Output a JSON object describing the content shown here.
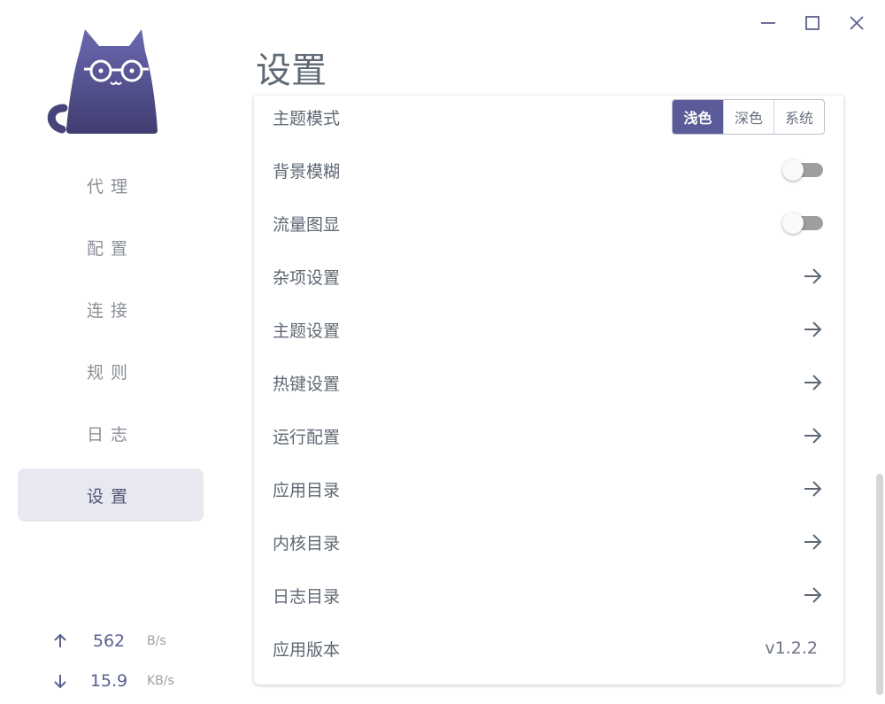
{
  "window": {
    "controls": [
      "minimize-icon",
      "maximize-icon",
      "close-icon"
    ],
    "icon_color": "#5b5f8f"
  },
  "sidebar": {
    "nav": [
      {
        "label": "代理",
        "active": false
      },
      {
        "label": "配置",
        "active": false
      },
      {
        "label": "连接",
        "active": false
      },
      {
        "label": "规则",
        "active": false
      },
      {
        "label": "日志",
        "active": false
      },
      {
        "label": "设置",
        "active": true
      }
    ],
    "traffic": {
      "upload": {
        "value": "562",
        "unit": "B/s"
      },
      "download": {
        "value": "15.9",
        "unit": "KB/s"
      }
    }
  },
  "page": {
    "title": "设置"
  },
  "settings": {
    "theme_mode": {
      "label": "主题模式",
      "options": [
        "浅色",
        "深色",
        "系统"
      ],
      "selected": "浅色"
    },
    "background_blur": {
      "label": "背景模糊",
      "enabled": false
    },
    "traffic_graph": {
      "label": "流量图显",
      "enabled": false
    },
    "links": [
      {
        "label": "杂项设置",
        "icon": "arrow-right-icon"
      },
      {
        "label": "主题设置",
        "icon": "arrow-right-icon"
      },
      {
        "label": "热键设置",
        "icon": "arrow-right-icon"
      },
      {
        "label": "运行配置",
        "icon": "arrow-right-icon"
      },
      {
        "label": "应用目录",
        "icon": "arrow-right-icon"
      },
      {
        "label": "内核目录",
        "icon": "arrow-right-icon"
      },
      {
        "label": "日志目录",
        "icon": "arrow-right-icon"
      }
    ],
    "version": {
      "label": "应用版本",
      "value": "v1.2.2"
    }
  },
  "colors": {
    "accent": "#5b5b99",
    "active_nav_bg": "#e8e8f0",
    "toggle_off": "#9e9e9e"
  }
}
